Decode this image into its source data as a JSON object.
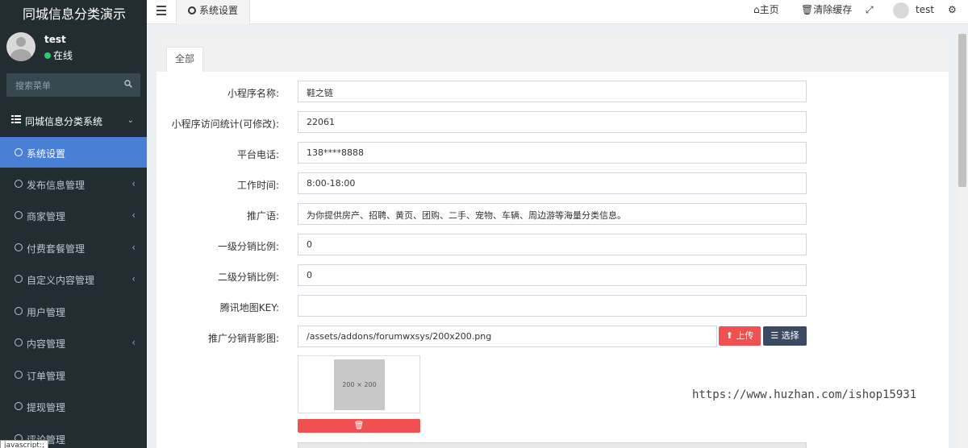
{
  "app": {
    "title": "同城信息分类演示"
  },
  "user": {
    "name": "test",
    "status": "在线"
  },
  "sidebar": {
    "search_placeholder": "搜索菜单",
    "group_label": "同城信息分类系统",
    "items": [
      {
        "label": "系统设置",
        "active": true,
        "has_caret": false
      },
      {
        "label": "发布信息管理",
        "has_caret": true
      },
      {
        "label": "商家管理",
        "has_caret": true
      },
      {
        "label": "付费套餐管理",
        "has_caret": true
      },
      {
        "label": "自定义内容管理",
        "has_caret": true
      },
      {
        "label": "用户管理",
        "has_caret": false
      },
      {
        "label": "内容管理",
        "has_caret": true
      },
      {
        "label": "订单管理",
        "has_caret": false
      },
      {
        "label": "提现管理",
        "has_caret": false
      },
      {
        "label": "评论管理",
        "has_caret": false
      }
    ],
    "footer_text": "javascript:;"
  },
  "topbar": {
    "tab_label": "系统设置",
    "home_label": "主页",
    "clear_cache_label": "清除缓存",
    "user_name": "test"
  },
  "content": {
    "tab_all": "全部",
    "fields": [
      {
        "label": "小程序名称:",
        "value": "鞋之链"
      },
      {
        "label": "小程序访问统计(可修改):",
        "value": "22061"
      },
      {
        "label": "平台电话:",
        "value": "138****8888"
      },
      {
        "label": "工作时间:",
        "value": "8:00-18:00"
      },
      {
        "label": "推广语:",
        "value": "为你提供房产、招聘、黄页、团购、二手、宠物、车辆、周边游等海量分类信息。"
      },
      {
        "label": "一级分销比例:",
        "value": "0"
      },
      {
        "label": "二级分销比例:",
        "value": "0"
      },
      {
        "label": "腾讯地图KEY:",
        "value": ""
      },
      {
        "label": "推广分销背影图:",
        "value": "/assets/addons/forumwxsys/200x200.png"
      }
    ],
    "upload_label": "上传",
    "select_label": "选择",
    "thumb_text": "200 × 200"
  },
  "watermark": {
    "url": "https://www.huzhan.com/ishop15931"
  },
  "colors": {
    "sidebar": "#222d32",
    "active": "#4a7fd6",
    "danger": "#f05050",
    "dark_button": "#3b4a63"
  }
}
